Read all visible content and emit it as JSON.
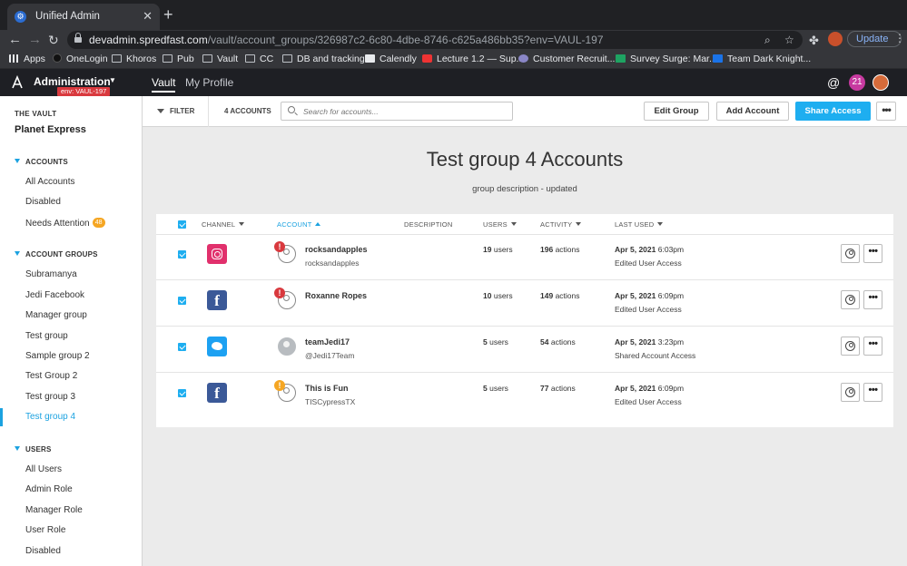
{
  "browser": {
    "tab_title": "Unified Admin",
    "url_domain": "devadmin.spredfast.com",
    "url_path": "/vault/account_groups/326987c2-6c80-4dbe-8746-c625a486bb35?env=VAUL-197",
    "update_label": "Update",
    "bookmarks": [
      "Apps",
      "OneLogin",
      "Khoros",
      "Pub",
      "Vault",
      "CC",
      "DB and tracking",
      "Calendly",
      "Lecture 1.2 — Sup...",
      "Customer Recruit...",
      "Survey Surge: Mar...",
      "Team Dark Knight..."
    ]
  },
  "appbar": {
    "app_name": "Administration",
    "env_badge": "env: VAUL-197",
    "nav": [
      "Vault",
      "My Profile"
    ],
    "notifications": "21",
    "at_symbol": "@"
  },
  "sidebar": {
    "vault_label": "THE VAULT",
    "vault_name": "Planet Express",
    "accounts_header": "ACCOUNTS",
    "accounts_items": [
      "All Accounts",
      "Disabled",
      "Needs Attention"
    ],
    "needs_attention_count": "48",
    "groups_header": "ACCOUNT GROUPS",
    "groups_items": [
      "Subramanya",
      "Jedi Facebook",
      "Manager group",
      "Test group",
      "Sample group 2",
      "Test Group 2",
      "Test group 3",
      "Test group 4"
    ],
    "users_header": "USERS",
    "users_items": [
      "All Users",
      "Admin Role",
      "Manager Role",
      "User Role",
      "Disabled"
    ]
  },
  "toolbar": {
    "filter_label": "FILTER",
    "account_count": "4 ACCOUNTS",
    "search_placeholder": "Search for accounts...",
    "edit_group": "Edit Group",
    "add_account": "Add Account",
    "share_access": "Share Access",
    "more": "•••"
  },
  "main": {
    "title": "Test group 4 Accounts",
    "description": "group description - updated"
  },
  "table": {
    "headers": {
      "channel": "CHANNEL",
      "account": "ACCOUNT",
      "description": "DESCRIPTION",
      "users": "USERS",
      "activity": "ACTIVITY",
      "last_used": "LAST USED"
    },
    "rows": [
      {
        "channel": "instagram",
        "alert": "red",
        "name": "rocksandapples",
        "handle": "rocksandapples",
        "users_num": "19",
        "users_unit": "users",
        "actions_num": "196",
        "actions_unit": "actions",
        "date": "Apr 5, 2021",
        "time": "6:03pm",
        "last_action": "Edited User Access"
      },
      {
        "channel": "facebook",
        "alert": "red",
        "name": "Roxanne Ropes",
        "handle": "",
        "users_num": "10",
        "users_unit": "users",
        "actions_num": "149",
        "actions_unit": "actions",
        "date": "Apr 5, 2021",
        "time": "6:09pm",
        "last_action": "Edited User Access"
      },
      {
        "channel": "twitter",
        "alert": "",
        "name": "teamJedi17",
        "handle": "@Jedi17Team",
        "users_num": "5",
        "users_unit": "users",
        "actions_num": "54",
        "actions_unit": "actions",
        "date": "Apr 5, 2021",
        "time": "3:23pm",
        "last_action": "Shared Account Access"
      },
      {
        "channel": "facebook",
        "alert": "orange",
        "name": "This is Fun",
        "handle": "TISCypressTX",
        "users_num": "5",
        "users_unit": "users",
        "actions_num": "77",
        "actions_unit": "actions",
        "date": "Apr 5, 2021",
        "time": "6:09pm",
        "last_action": "Edited User Access"
      }
    ]
  }
}
